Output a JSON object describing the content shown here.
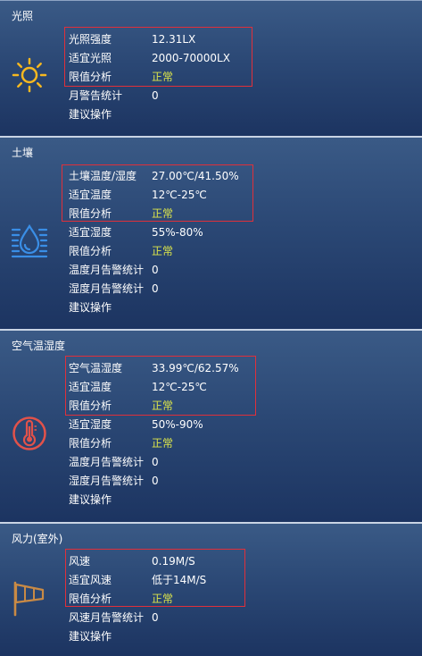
{
  "panels": [
    {
      "title": "光照",
      "icon": "sun-icon",
      "accent": "#f6b820",
      "rows": [
        {
          "label": "光照强度",
          "value": "12.31LX"
        },
        {
          "label": "适宜光照",
          "value": "2000-70000LX"
        },
        {
          "label": "限值分析",
          "value": "正常"
        },
        {
          "label": "月警告统计",
          "value": "0"
        },
        {
          "label": "建议操作",
          "value": ""
        }
      ]
    },
    {
      "title": "土壤",
      "icon": "soil-moisture-icon",
      "accent": "#3a8ee6",
      "rows": [
        {
          "label": "土壤温度/湿度",
          "value": "27.00℃/41.50%"
        },
        {
          "label": "适宜温度",
          "value": "12℃-25℃"
        },
        {
          "label": "限值分析",
          "value": "正常"
        },
        {
          "label": "适宜湿度",
          "value": "55%-80%"
        },
        {
          "label": "限值分析",
          "value": "正常"
        },
        {
          "label": "温度月告警统计",
          "value": "0"
        },
        {
          "label": "湿度月告警统计",
          "value": "0"
        },
        {
          "label": "建议操作",
          "value": ""
        }
      ]
    },
    {
      "title": "空气温湿度",
      "icon": "thermometer-icon",
      "accent": "#e2524a",
      "rows": [
        {
          "label": "空气温湿度",
          "value": "33.99℃/62.57%"
        },
        {
          "label": "适宜温度",
          "value": "12℃-25℃"
        },
        {
          "label": "限值分析",
          "value": "正常"
        },
        {
          "label": "适宜湿度",
          "value": "50%-90%"
        },
        {
          "label": "限值分析",
          "value": "正常"
        },
        {
          "label": "温度月告警统计",
          "value": "0"
        },
        {
          "label": "湿度月告警统计",
          "value": "0"
        },
        {
          "label": "建议操作",
          "value": ""
        }
      ]
    },
    {
      "title": "风力(室外)",
      "icon": "windsock-icon",
      "accent": "#c98a45",
      "rows": [
        {
          "label": "风速",
          "value": "0.19M/S"
        },
        {
          "label": "适宜风速",
          "value": "低于14M/S"
        },
        {
          "label": "限值分析",
          "value": "正常"
        },
        {
          "label": "风速月告警统计",
          "value": "0"
        },
        {
          "label": "建议操作",
          "value": ""
        }
      ]
    }
  ],
  "colors": {
    "normal_status": "#dbe44a",
    "highlight_border": "#e0303a"
  }
}
